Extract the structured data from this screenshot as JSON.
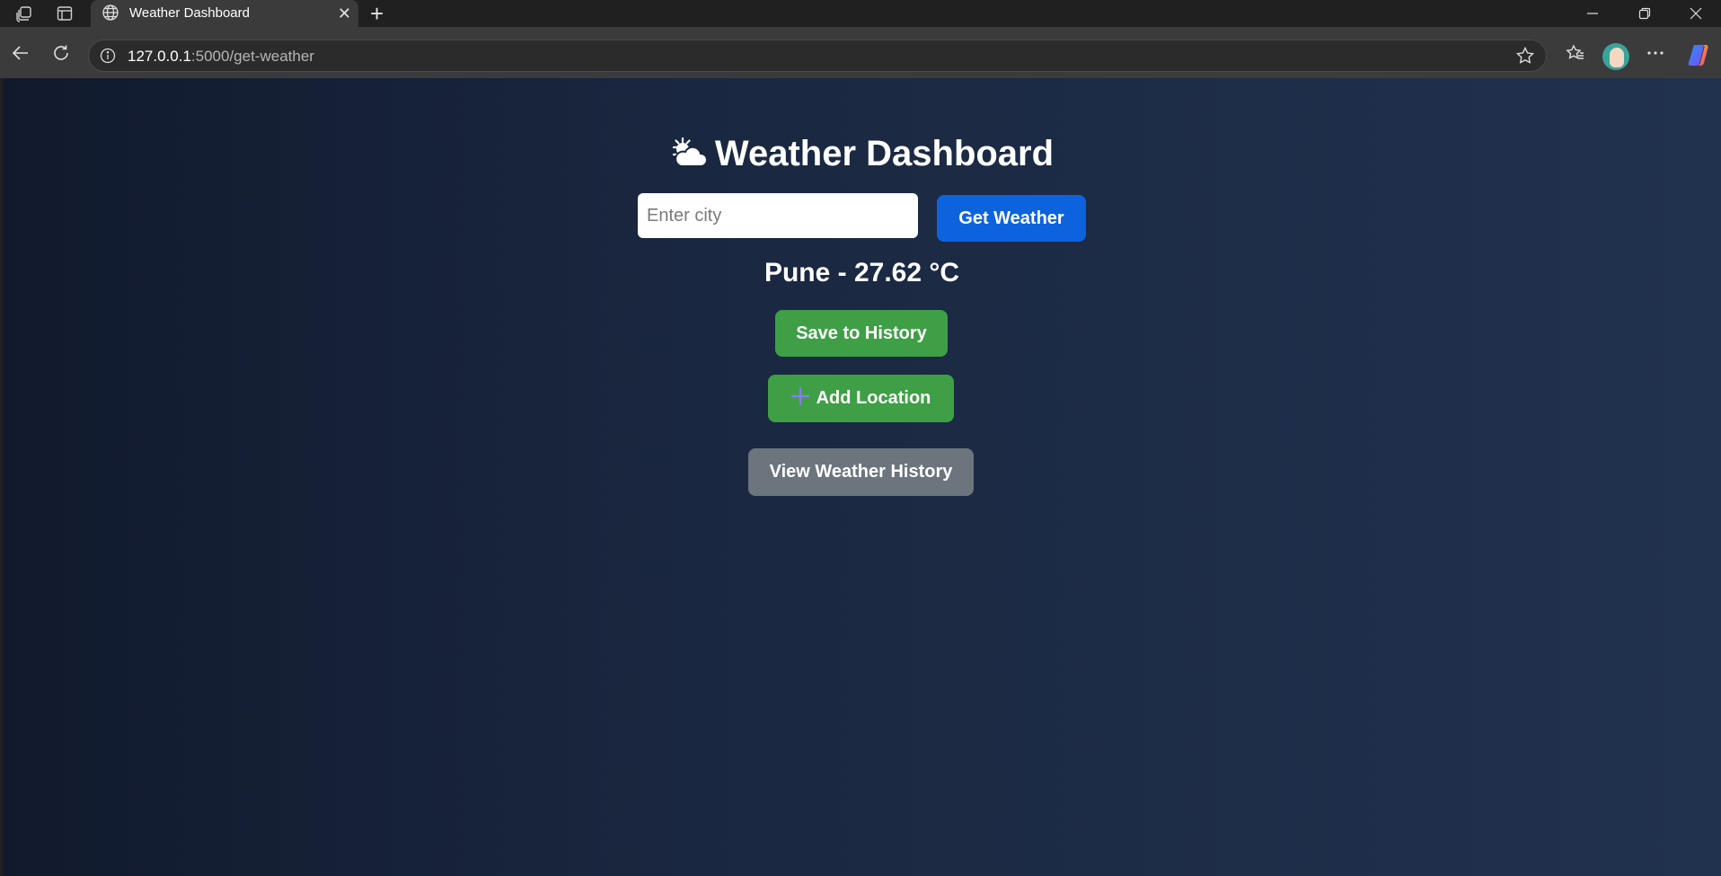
{
  "browser": {
    "tab_title": "Weather Dashboard",
    "url_host": "127.0.0.1",
    "url_path": ":5000/get-weather"
  },
  "page": {
    "title": "Weather Dashboard",
    "title_icon": "sun-behind-cloud-icon",
    "search": {
      "placeholder": "Enter city",
      "value": "",
      "button_label": "Get Weather"
    },
    "result": "Pune - 27.62 °C",
    "buttons": {
      "save": "Save to History",
      "add_location": "Add Location",
      "view_history": "View Weather History"
    }
  },
  "colors": {
    "primary": "#0d63de",
    "success": "#3f9f46",
    "secondary": "#6c757d",
    "bg_start": "#111a2d",
    "bg_end": "#21324f"
  }
}
